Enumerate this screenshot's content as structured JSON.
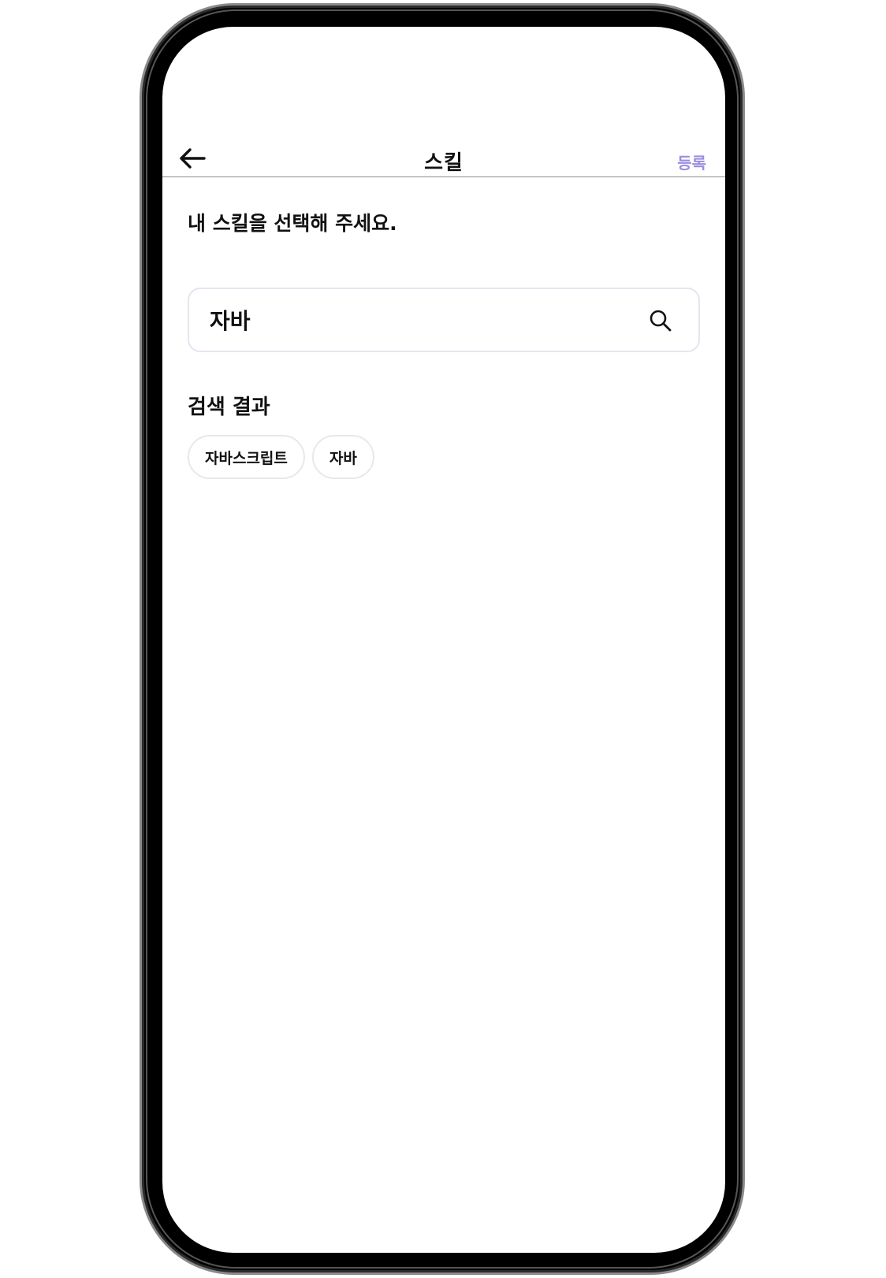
{
  "header": {
    "title": "스킬",
    "register_label": "등록",
    "back_icon": "arrow-left-icon"
  },
  "prompt": "내 스킬을 선택해 주세요.",
  "search": {
    "value": "자바",
    "icon": "search-icon"
  },
  "results": {
    "title": "검색 결과",
    "items": [
      {
        "label": "자바스크립트"
      },
      {
        "label": "자바"
      }
    ]
  },
  "colors": {
    "accent": "#9a8de0",
    "text": "#111111",
    "border": "#e4e6ef"
  }
}
